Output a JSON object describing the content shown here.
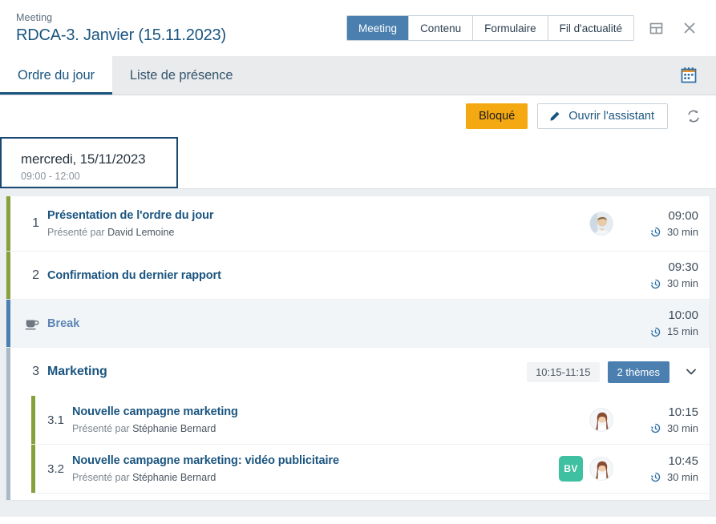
{
  "header": {
    "kicker": "Meeting",
    "title": "RDCA-3. Janvier (15.11.2023)",
    "tabs": [
      {
        "label": "Meeting",
        "active": true
      },
      {
        "label": "Contenu",
        "active": false
      },
      {
        "label": "Formulaire",
        "active": false
      },
      {
        "label": "Fil d'actualité",
        "active": false
      }
    ],
    "layout_icon": "panel-layout-icon",
    "close_icon": "close-icon"
  },
  "subtabs": {
    "items": [
      {
        "label": "Ordre du jour",
        "active": true
      },
      {
        "label": "Liste de présence",
        "active": false
      }
    ],
    "calendar_icon": "calendar-icon"
  },
  "toolbar": {
    "blocked_label": "Bloqué",
    "assistant_label": "Ouvrir l'assistant",
    "assistant_icon": "pencil-icon",
    "refresh_icon": "refresh-icon"
  },
  "day": {
    "title": "mercredi, 15/11/2023",
    "time_range": "09:00 - 12:00"
  },
  "agenda": {
    "presented_by_prefix": "Présenté par",
    "items": [
      {
        "kind": "item",
        "number": "1",
        "title": "Présentation de l'ordre du jour",
        "presenter": "David Lemoine",
        "start": "09:00",
        "duration": "30 min",
        "bar_color": "#86a03a",
        "avatar": "male-avatar",
        "initials": null
      },
      {
        "kind": "item",
        "number": "2",
        "title": "Confirmation du dernier rapport",
        "presenter": null,
        "start": "09:30",
        "duration": "30 min",
        "bar_color": "#86a03a",
        "avatar": null,
        "initials": null
      },
      {
        "kind": "break",
        "label": "Break",
        "icon": "coffee-cup-icon",
        "start": "10:00",
        "duration": "15 min",
        "bar_color": "#4a7fb0"
      },
      {
        "kind": "group",
        "number": "3",
        "title": "Marketing",
        "time_badge": "10:15-11:15",
        "count_badge": "2 thèmes",
        "chevron": "chevron-down-icon",
        "bar_color": "#a9b9c7",
        "children": [
          {
            "number": "3.1",
            "title": "Nouvelle campagne marketing",
            "presenter": "Stéphanie Bernard",
            "start": "10:15",
            "duration": "30 min",
            "bar_color": "#86a03a",
            "avatar": "female-avatar",
            "initials": null
          },
          {
            "number": "3.2",
            "title": "Nouvelle campagne marketing: vidéo publicitaire",
            "presenter": "Stéphanie Bernard",
            "start": "10:45",
            "duration": "30 min",
            "bar_color": "#86a03a",
            "avatar": "female-avatar",
            "initials": "BV"
          }
        ]
      }
    ]
  },
  "colors": {
    "accent_blue": "#1a5580",
    "tab_blue": "#4a7fb0",
    "warning_orange": "#f4a811",
    "green_bar": "#86a03a",
    "teal_badge": "#3fc0a0",
    "gray_bar": "#a9b9c7"
  }
}
